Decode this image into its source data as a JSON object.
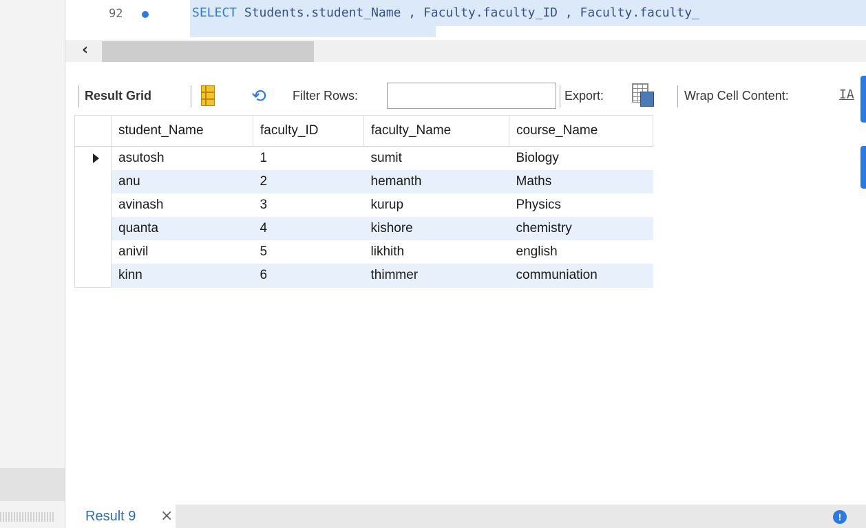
{
  "editor": {
    "line_number": "92",
    "sql_keyword": "SELECT",
    "sql_rest": " Students.student_Name , Faculty.faculty_ID , Faculty.faculty_"
  },
  "toolbar": {
    "result_grid_label": "Result Grid",
    "filter_label": "Filter Rows:",
    "filter_value": "",
    "export_label": "Export:",
    "wrap_label": "Wrap Cell Content:",
    "wrap_icon_glyph": "IA"
  },
  "grid": {
    "columns": [
      "student_Name",
      "faculty_ID",
      "faculty_Name",
      "course_Name"
    ],
    "rows": [
      [
        "asutosh",
        "1",
        "sumit",
        "Biology"
      ],
      [
        "anu",
        "2",
        "hemanth",
        "Maths"
      ],
      [
        "avinash",
        "3",
        "kurup",
        "Physics"
      ],
      [
        "quanta",
        "4",
        "kishore",
        "chemistry"
      ],
      [
        "anivil",
        "5",
        "likhith",
        "english"
      ],
      [
        "kinn",
        "6",
        "thimmer",
        "communiation"
      ]
    ],
    "selected_row": 0
  },
  "tabs": {
    "result_tab_label": "Result 9",
    "close_glyph": "×",
    "info_glyph": "!"
  },
  "icons": {
    "scroll_left": "chevron-left-icon",
    "grid": "result-grid-icon",
    "refresh": "refresh-icon",
    "export": "export-icon",
    "wrap": "wrap-cell-icon",
    "info": "info-icon"
  },
  "colors": {
    "accent": "#2a7ae2",
    "selection": "#dbe9f9",
    "alt_row": "#e8f0fb"
  }
}
